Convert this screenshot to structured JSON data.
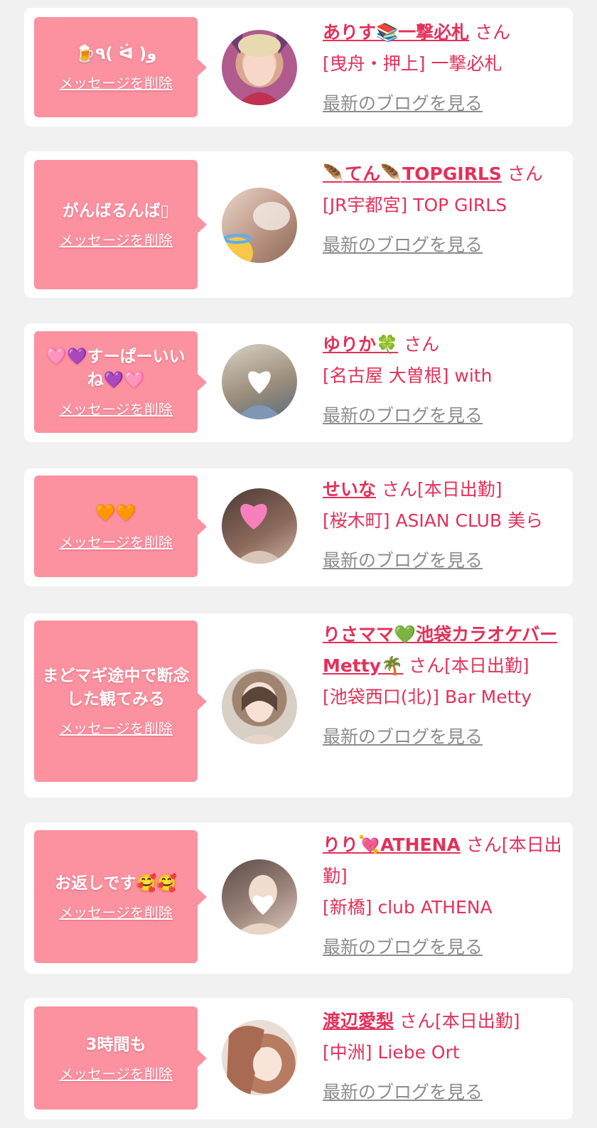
{
  "delete_label": "メッセージを削除",
  "blog_label": "最新のブログを見る",
  "colors": {
    "accent": "#e2315a",
    "bubble": "#fc91a0",
    "page_bg": "#f1f1f1",
    "muted": "#8c8c8c"
  },
  "items": [
    {
      "message": "🍺٩( ᐛ )و",
      "name": "ありす📚一撃必札",
      "suffix": "さん",
      "shop": "[曳舟・押上] 一撃必札"
    },
    {
      "message": "がんばるんば▯",
      "name": "🪶てん🪶TOPGIRLS",
      "suffix": "さん",
      "shop": "[JR宇都宮] TOP GIRLS"
    },
    {
      "message": "🩷💜すーぱーいいね💜🩷",
      "name": "ゆりか🍀",
      "suffix": "さん",
      "shop": "[名古屋 大曽根] with"
    },
    {
      "message": "🧡🧡",
      "name": "せいな",
      "suffix": "さん[本日出勤]",
      "shop": "[桜木町] ASIAN CLUB 美ら"
    },
    {
      "message": "まどマギ途中で断念した観てみる",
      "name": "りさママ💚池袋カラオケバーMetty🌴",
      "suffix": "さん[本日出勤]",
      "shop": "[池袋西口(北)] Bar Metty"
    },
    {
      "message": "お返しです🥰🥰",
      "name": "りり💘ATHENA",
      "suffix": "さん[本日出勤]",
      "shop": "[新橋] club ATHENA"
    },
    {
      "message": "3時間も",
      "name": "渡辺愛梨",
      "suffix": "さん[本日出勤]",
      "shop": "[中洲] Liebe Ort"
    }
  ]
}
